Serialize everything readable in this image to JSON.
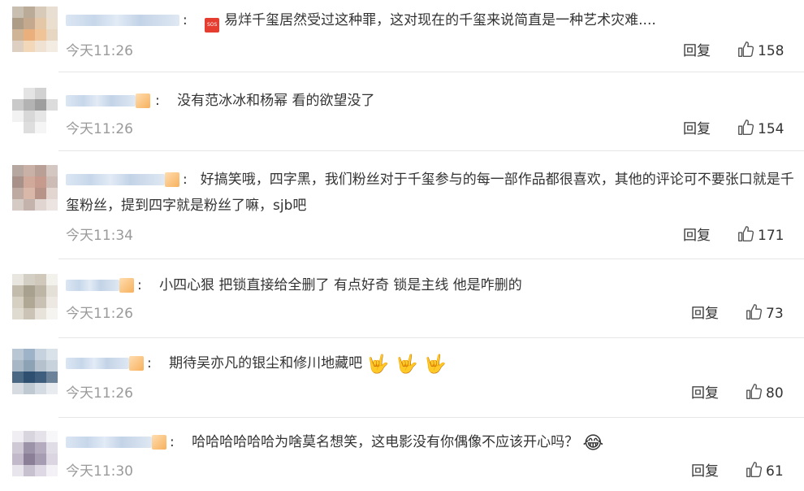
{
  "icons": {
    "sos": "sos-icon",
    "thumb": "thumb-up-icon",
    "rock_hand": "rock-on-hand-emoji",
    "laugh": "tears-of-joy-emoji"
  },
  "comments": [
    {
      "text": "易烊千玺居然受过这种罪，这对现在的千玺来说简直是一种艺术灾难....",
      "sos_label": "SOS",
      "time": "今天11:26",
      "reply": "回复",
      "likes": "158"
    },
    {
      "text": "没有范冰冰和杨幂 看的欲望没了",
      "time": "今天11:26",
      "reply": "回复",
      "likes": "154"
    },
    {
      "text": "好搞笑哦，四字黑，我们粉丝对于千玺参与的每一部作品都很喜欢，其他的评论可不要张口就是千玺粉丝，提到四字就是粉丝了嘛，sjb吧",
      "time": "今天11:34",
      "reply": "回复",
      "likes": "171"
    },
    {
      "text": "小四心狠 把锁直接给全删了 有点好奇 锁是主线 他是咋删的",
      "time": "今天11:26",
      "reply": "回复",
      "likes": "73"
    },
    {
      "text": "期待吴亦凡的银尘和修川地藏吧",
      "time": "今天11:26",
      "reply": "回复",
      "likes": "80"
    },
    {
      "text": "哈哈哈哈哈哈为啥莫名想笑，这电影没有你偶像不应该开心吗？",
      "time": "今天11:30",
      "reply": "回复",
      "likes": "61"
    }
  ]
}
